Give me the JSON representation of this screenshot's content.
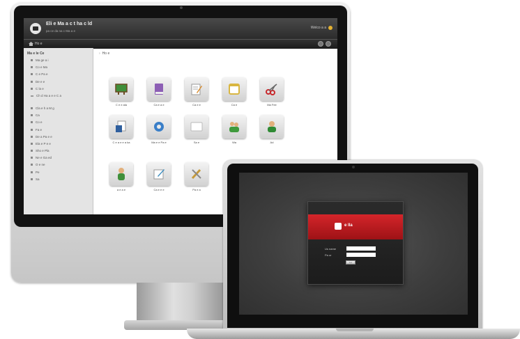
{
  "imac": {
    "app": {
      "title": "Eli  e  Ma  a  c  t  ha  c  ld",
      "subtitle": "pa     ce   da    na   c   Ma   a   e  ",
      "user": "Welco    a   a   "
    },
    "toolbar": {
      "label": "Ho e"
    },
    "sidebar": {
      "heading": "Ma   e  le Ce  ",
      "items": [
        "Ma  ge   a  i  ",
        "Co  e  Ma  ",
        "C  e  Pa  e",
        "De  e  e",
        "C  la  e",
        "Ch  d Ha  a  e  e  C   a",
        "Cla   e  h  a  M g",
        "Ca  ",
        "Co  e",
        "Fa   e",
        "De  a  Pa  e  e",
        "Ela  e P  e  e ",
        "Sho  e  Pla  ",
        "Ne  e  Ga   ed",
        "O   e  ne",
        "Pe   ",
        "Sa  "
      ]
    },
    "main": {
      "breadcrumb": "Ho e",
      "tiles": [
        {
          "label": "C e e  ala",
          "icon": "chalkboard-icon",
          "color": "#3f8f3a"
        },
        {
          "label": "Ca  e a e ",
          "icon": "book-icon",
          "color": "#8d5fb5"
        },
        {
          "label": "Ca  e  e",
          "icon": "edit-document-icon",
          "color": "#8a8a8a"
        },
        {
          "label": "Ca  e  ",
          "icon": "notepad-icon",
          "color": "#d9b640"
        },
        {
          "label": "Ma  Fee",
          "icon": "scissors-icon",
          "color": "#c8282c"
        },
        {
          "label": "C  e  a e  e a  ka",
          "icon": "report-icon",
          "color": "#2f5f9e"
        },
        {
          "label": "Ma  e e  Pa  e",
          "icon": "gear-icon",
          "color": "#3a7fc8"
        },
        {
          "label": "Sa  e",
          "icon": "blank-page-icon",
          "color": "#bbbbbb"
        },
        {
          "label": "Wa  ",
          "icon": "users-icon",
          "color": "#3f9a3c"
        },
        {
          "label": "Ad  ",
          "icon": "user-icon",
          "color": "#2f8a34"
        },
        {
          "label": "a  e  a  e ",
          "icon": "student-icon",
          "color": "#3f8f3a"
        },
        {
          "label": "Ca  e  e    e",
          "icon": "write-icon",
          "color": "#3f8fc0"
        },
        {
          "label": "Pa  e  a  ",
          "icon": "tools-icon",
          "color": "#c69a3a"
        }
      ]
    }
  },
  "laptop": {
    "login": {
      "brand": "e  lla  ",
      "username_label": "Us  name",
      "password_label": "Pa   or",
      "username_value": "",
      "password_value": "",
      "button_label": "Lo  "
    },
    "accent": "#c8202a"
  }
}
